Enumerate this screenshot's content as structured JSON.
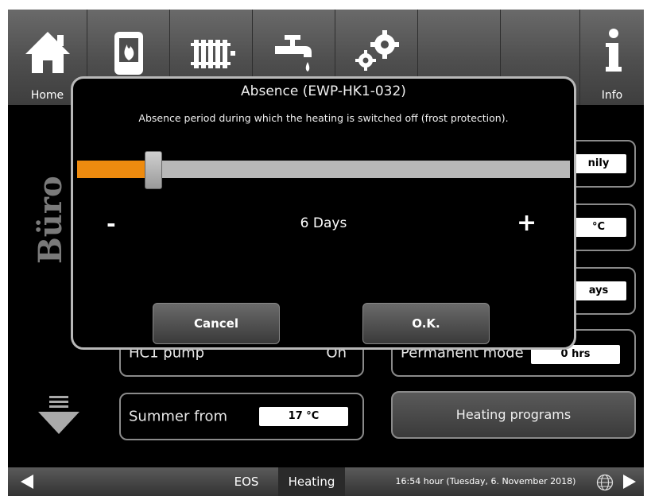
{
  "nav": {
    "home_label": "Home",
    "info_label": "Info"
  },
  "side_label": "Büro",
  "panels": {
    "hc1_pump_label": "HC1 pump",
    "hc1_pump_value": "On",
    "permanent_mode_label": "Permanent mode",
    "permanent_mode_value": "0 hrs",
    "summer_from_label": "Summer from",
    "summer_from_value": "17 °C",
    "right_value_1": "nily",
    "right_value_2": "°C",
    "right_value_3": "ays",
    "heating_programs_label": "Heating programs"
  },
  "bottom": {
    "tab_eos": "EOS",
    "tab_heating": "Heating",
    "status_text": "16:54 hour (Tuesday, 6. November 2018)"
  },
  "dialog": {
    "title": "Absence (EWP-HK1-032)",
    "description": "Absence period during which the heating is switched off (frost protection).",
    "minus_label": "-",
    "plus_label": "+",
    "value_text": "6 Days",
    "slider_fraction": 0.14,
    "cancel_label": "Cancel",
    "ok_label": "O.K."
  },
  "colors": {
    "accent": "#ee8b0f",
    "background": "#000000"
  },
  "icons": [
    "home-icon",
    "boiler-flame-icon",
    "radiator-icon",
    "water-tap-icon",
    "gears-icon",
    "info-icon",
    "arrow-down-icon",
    "arrow-left-icon",
    "arrow-right-icon",
    "globe-icon"
  ]
}
